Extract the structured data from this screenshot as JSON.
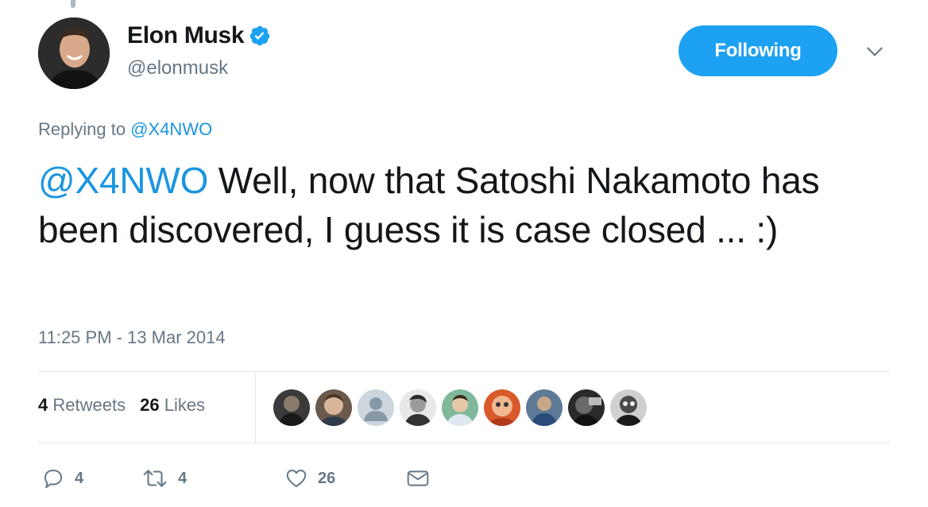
{
  "user": {
    "display_name": "Elon Musk",
    "handle": "@elonmusk",
    "avatar_icon": "avatar-photo",
    "verified_icon": "verified-badge-icon"
  },
  "follow_button": {
    "label": "Following"
  },
  "menu_icon": "chevron-down-icon",
  "reply_context": {
    "prefix": "Replying to ",
    "mention": "@X4NWO"
  },
  "tweet": {
    "mention": "@X4NWO",
    "text": " Well, now that Satoshi Nakamoto has been discovered, I guess it is case closed ... :)"
  },
  "timestamp": "11:25 PM - 13 Mar 2014",
  "stats": {
    "retweets_count": "4",
    "retweets_label": "Retweets",
    "likes_count": "26",
    "likes_label": "Likes"
  },
  "likers": [
    "liker-avatar-1",
    "liker-avatar-2",
    "liker-avatar-3",
    "liker-avatar-4",
    "liker-avatar-5",
    "liker-avatar-6",
    "liker-avatar-7",
    "liker-avatar-8",
    "liker-avatar-9"
  ],
  "actions": {
    "reply_count": "4",
    "retweet_count": "4",
    "like_count": "26"
  },
  "colors": {
    "accent": "#1da1f2",
    "link": "#1b95e0",
    "secondary_text": "#657786",
    "primary_text": "#14171a",
    "divider": "#e1e8ed"
  }
}
